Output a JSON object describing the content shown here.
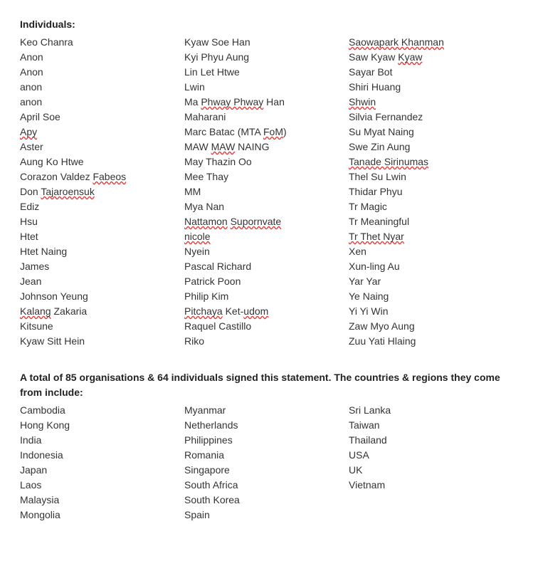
{
  "individuals": {
    "heading": "Individuals:",
    "col1": [
      {
        "text": "Keo Chanra"
      },
      {
        "text": "Anon"
      },
      {
        "text": "Anon"
      },
      {
        "text": "anon"
      },
      {
        "text": "anon"
      },
      {
        "text": "April Soe"
      },
      {
        "pre": "",
        "red": "Apy",
        "post": ""
      },
      {
        "text": "Aster"
      },
      {
        "text": "Aung Ko Htwe"
      },
      {
        "pre": "Corazon Valdez ",
        "red": "Fabeos",
        "post": ""
      },
      {
        "pre": "Don ",
        "red": "Tajaroensuk",
        "post": ""
      },
      {
        "text": "Ediz"
      },
      {
        "text": "Hsu"
      },
      {
        "text": "Htet"
      },
      {
        "text": "Htet Naing"
      },
      {
        "text": "James"
      },
      {
        "text": "Jean"
      },
      {
        "text": "Johnson Yeung"
      },
      {
        "pre": "",
        "red": "Kalang",
        "post": " Zakaria"
      },
      {
        "text": "Kitsune"
      },
      {
        "text": "Kyaw Sitt Hein"
      }
    ],
    "col2": [
      {
        "text": "Kyaw Soe Han"
      },
      {
        "text": "Kyi Phyu Aung"
      },
      {
        "text": "Lin Let Htwe"
      },
      {
        "text": "Lwin"
      },
      {
        "pre": "Ma ",
        "red": "Phway Phway",
        "post": " Han"
      },
      {
        "text": "Maharani"
      },
      {
        "pre": "Marc Batac (MTA ",
        "red": "FoM",
        "post": ")"
      },
      {
        "pre": "MAW ",
        "red": "MAW",
        "post": " NAING"
      },
      {
        "text": "May Thazin Oo"
      },
      {
        "text": "Mee Thay"
      },
      {
        "text": "MM"
      },
      {
        "text": "Mya Nan"
      },
      {
        "pre": "",
        "red": "Nattamon",
        "post": " ",
        "red2": "Supornvate"
      },
      {
        "pre": "",
        "red": "nicole",
        "post": ""
      },
      {
        "text": "Nyein"
      },
      {
        "text": "Pascal Richard"
      },
      {
        "text": "Patrick Poon"
      },
      {
        "text": "Philip Kim"
      },
      {
        "pre": "",
        "red": "Pitchaya",
        "post": " Ket-",
        "red2": "udom"
      },
      {
        "text": "Raquel Castillo"
      },
      {
        "text": "Riko"
      }
    ],
    "col3": [
      {
        "pre": "",
        "red": "Saowapark Khanman",
        "post": ""
      },
      {
        "pre": "Saw Kyaw ",
        "red": "Kyaw",
        "post": ""
      },
      {
        "text": "Sayar Bot"
      },
      {
        "text": "Shiri Huang"
      },
      {
        "pre": "",
        "red": "Shwin",
        "post": ""
      },
      {
        "text": "Silvia Fernandez"
      },
      {
        "text": "Su Myat Naing"
      },
      {
        "text": "Swe Zin Aung"
      },
      {
        "pre": "",
        "red": "Tanade Sirinumas",
        "post": ""
      },
      {
        "text": "Thel Su Lwin"
      },
      {
        "text": "Thidar Phyu"
      },
      {
        "text": "Tr Magic"
      },
      {
        "text": "Tr Meaningful"
      },
      {
        "pre": "",
        "red": "Tr Thet Nyar",
        "post": ""
      },
      {
        "text": "Xen"
      },
      {
        "text": "Xun-ling Au"
      },
      {
        "text": "Yar Yar"
      },
      {
        "text": "Ye Naing"
      },
      {
        "text": "Yi Yi Win"
      },
      {
        "text": "Zaw Myo Aung"
      },
      {
        "text": "Zuu Yati Hlaing"
      }
    ]
  },
  "summary": {
    "heading": "A total of 85 organisations & 64 individuals signed this statement. The countries & regions they come from include:",
    "col1": [
      "Cambodia",
      "Hong Kong",
      "India",
      "Indonesia",
      "Japan",
      "Laos",
      "Malaysia",
      "Mongolia"
    ],
    "col2": [
      "Myanmar",
      "Netherlands",
      "Philippines",
      "Romania",
      "Singapore",
      "South Africa",
      "South Korea",
      "Spain"
    ],
    "col3": [
      "Sri Lanka",
      "Taiwan",
      "Thailand",
      "USA",
      "UK",
      "Vietnam"
    ]
  }
}
